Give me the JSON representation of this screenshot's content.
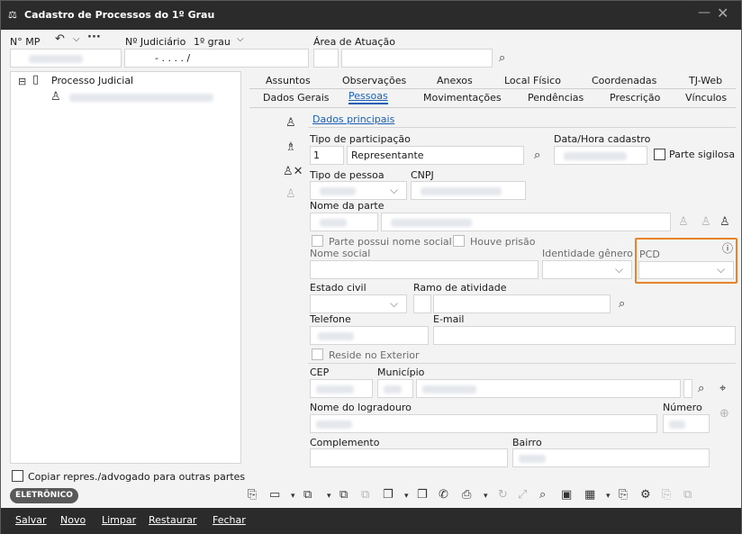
{
  "window": {
    "title": "Cadastro de Processos do 1º Grau",
    "minimize": "—",
    "close": "✕"
  },
  "header": {
    "nmp_label": "N° MP",
    "judiciario_label": "Nº Judiciário",
    "grau_label": "1º grau",
    "judiciario_value": "- . . . . /",
    "area_label": "Área de Atuação"
  },
  "tree": {
    "root_label": "Processo Judicial"
  },
  "left_bottom": {
    "copiar_label": "Copiar repres./advogado para outras partes",
    "badge": "ELETRÔNICO"
  },
  "tabs_row1": [
    "Assuntos",
    "Observações",
    "Anexos",
    "Local Físico",
    "Coordenadas",
    "TJ-Web"
  ],
  "tabs_row2": [
    "Dados Gerais",
    "Pessoas",
    "Movimentações",
    "Pendências",
    "Prescrição",
    "Vínculos"
  ],
  "subtab": "Dados principais",
  "form": {
    "tipo_participacao_label": "Tipo de participação",
    "tipo_participacao_code": "1",
    "tipo_participacao_value": "Representante",
    "data_cadastro_label": "Data/Hora cadastro",
    "parte_sigilosa_label": "Parte sigilosa",
    "tipo_pessoa_label": "Tipo de pessoa",
    "cnpj_label": "CNPJ",
    "nome_parte_label": "Nome da parte",
    "nome_social_check_label": "Parte possui nome social",
    "houve_prisao_label": "Houve prisão",
    "nome_social_label": "Nome social",
    "identidade_genero_label": "Identidade gênero",
    "pcd_label": "PCD",
    "estado_civil_label": "Estado civil",
    "ramo_atividade_label": "Ramo de atividade",
    "telefone_label": "Telefone",
    "email_label": "E-mail",
    "reside_exterior_label": "Reside no Exterior",
    "cep_label": "CEP",
    "municipio_label": "Município",
    "logradouro_label": "Nome do logradouro",
    "numero_label": "Número",
    "complemento_label": "Complemento",
    "bairro_label": "Bairro"
  },
  "footer": {
    "salvar": "Salvar",
    "novo": "Novo",
    "limpar": "Limpar",
    "restaurar": "Restaurar",
    "fechar": "Fechar"
  }
}
